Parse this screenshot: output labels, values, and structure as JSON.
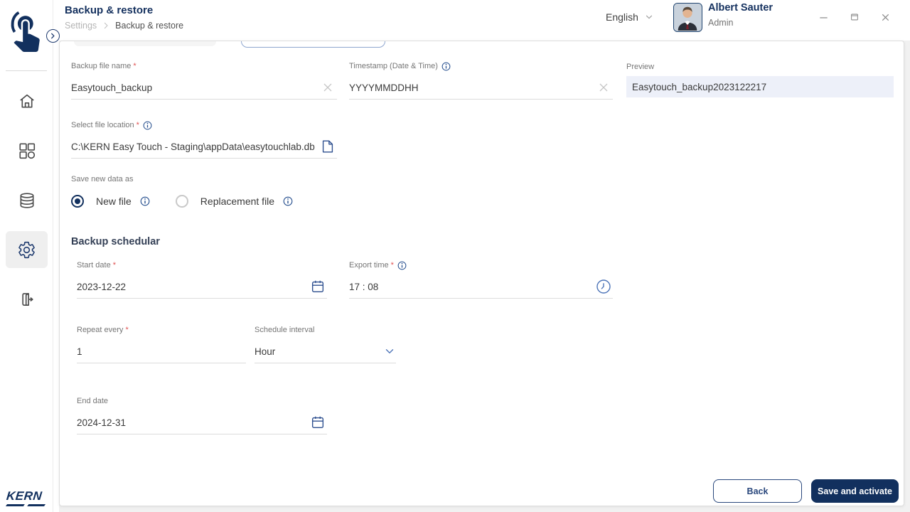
{
  "header": {
    "title": "Backup & restore",
    "breadcrumb": {
      "parent": "Settings",
      "current": "Backup & restore"
    },
    "language": {
      "value": "English"
    },
    "user": {
      "name": "Albert Sauter",
      "role": "Admin"
    }
  },
  "sidebar": {
    "brand": "KERN",
    "items": [
      {
        "name": "home",
        "active": false
      },
      {
        "name": "apps",
        "active": false
      },
      {
        "name": "database",
        "active": false
      },
      {
        "name": "settings",
        "active": true
      },
      {
        "name": "logout",
        "active": false
      }
    ]
  },
  "ui": {
    "asterisk": "*",
    "separator": "›"
  },
  "form": {
    "backup_file_name": {
      "label": "Backup file name",
      "required": true,
      "value": "Easytouch_backup"
    },
    "timestamp": {
      "label": "Timestamp (Date & Time)",
      "value": "YYYYMMDDHH"
    },
    "preview": {
      "label": "Preview",
      "value": "Easytouch_backup2023122217"
    },
    "file_location": {
      "label": "Select file location",
      "required": true,
      "value": "C:\\KERN Easy Touch - Staging\\appData\\easytouchlab.db"
    },
    "save_new_data_as": {
      "label": "Save new data as",
      "options": [
        {
          "label": "New file",
          "selected": true
        },
        {
          "label": "Replacement file",
          "selected": false
        }
      ]
    },
    "scheduler": {
      "heading": "Backup schedular",
      "start_date": {
        "label": "Start date",
        "required": true,
        "value": "2023-12-22"
      },
      "export_time": {
        "label": "Export time",
        "required": true,
        "value": "17 : 08"
      },
      "repeat_every": {
        "label": "Repeat every",
        "required": true,
        "value": "1"
      },
      "schedule_interval": {
        "label": "Schedule interval",
        "value": "Hour"
      },
      "end_date": {
        "label": "End date",
        "value": "2024-12-31"
      }
    }
  },
  "actions": {
    "back": "Back",
    "save": "Save and activate"
  },
  "colors": {
    "navy": "#12305e",
    "icon_blue": "#2d4f8f",
    "label_gray": "#757575",
    "value_dark": "#3a3a3a",
    "required_red": "#e05252",
    "preview_bg": "#edf0f9"
  }
}
